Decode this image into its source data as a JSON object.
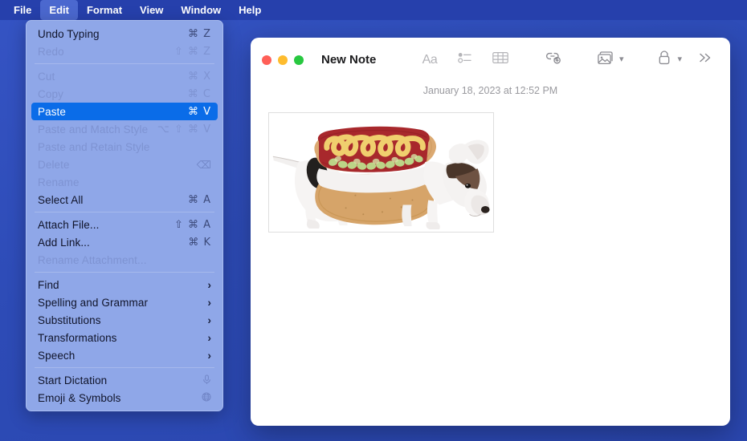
{
  "menubar": {
    "items": [
      {
        "label": "File",
        "active": false
      },
      {
        "label": "Edit",
        "active": true
      },
      {
        "label": "Format",
        "active": false
      },
      {
        "label": "View",
        "active": false
      },
      {
        "label": "Window",
        "active": false
      },
      {
        "label": "Help",
        "active": false
      }
    ]
  },
  "edit_menu": {
    "groups": [
      {
        "rows": [
          {
            "label": "Undo Typing",
            "accel": "⌘ Z",
            "state": "enabled",
            "trailing": ""
          },
          {
            "label": "Redo",
            "accel": "⇧ ⌘ Z",
            "state": "disabled",
            "trailing": ""
          }
        ]
      },
      {
        "rows": [
          {
            "label": "Cut",
            "accel": "⌘ X",
            "state": "disabled",
            "trailing": ""
          },
          {
            "label": "Copy",
            "accel": "⌘ C",
            "state": "disabled",
            "trailing": ""
          },
          {
            "label": "Paste",
            "accel": "⌘ V",
            "state": "highlighted",
            "trailing": ""
          },
          {
            "label": "Paste and Match Style",
            "accel": "⌥ ⇧ ⌘ V",
            "state": "disabled",
            "trailing": ""
          },
          {
            "label": "Paste and Retain Style",
            "accel": "",
            "state": "disabled",
            "trailing": ""
          },
          {
            "label": "Delete",
            "accel": "",
            "state": "disabled",
            "trailing": "⌫"
          },
          {
            "label": "Rename",
            "accel": "",
            "state": "disabled",
            "trailing": ""
          },
          {
            "label": "Select All",
            "accel": "⌘ A",
            "state": "enabled",
            "trailing": ""
          }
        ]
      },
      {
        "rows": [
          {
            "label": "Attach File...",
            "accel": "⇧ ⌘ A",
            "state": "enabled",
            "trailing": ""
          },
          {
            "label": "Add Link...",
            "accel": "⌘ K",
            "state": "enabled",
            "trailing": ""
          },
          {
            "label": "Rename Attachment...",
            "accel": "",
            "state": "disabled",
            "trailing": ""
          }
        ]
      },
      {
        "rows": [
          {
            "label": "Find",
            "accel": "",
            "state": "enabled",
            "trailing": "›"
          },
          {
            "label": "Spelling and Grammar",
            "accel": "",
            "state": "enabled",
            "trailing": "›"
          },
          {
            "label": "Substitutions",
            "accel": "",
            "state": "enabled",
            "trailing": "›"
          },
          {
            "label": "Transformations",
            "accel": "",
            "state": "enabled",
            "trailing": "›"
          },
          {
            "label": "Speech",
            "accel": "",
            "state": "enabled",
            "trailing": "›"
          }
        ]
      },
      {
        "rows": [
          {
            "label": "Start Dictation",
            "accel": "",
            "state": "enabled",
            "trailing": "🎙"
          },
          {
            "label": "Emoji & Symbols",
            "accel": "",
            "state": "enabled",
            "trailing": "☼"
          }
        ]
      }
    ]
  },
  "notes_window": {
    "title": "New Note",
    "traffic_lights": [
      {
        "name": "close",
        "color": "#ff5f57"
      },
      {
        "name": "minimize",
        "color": "#febc2e"
      },
      {
        "name": "maximize",
        "color": "#28c840"
      }
    ],
    "toolbar": [
      {
        "icon": "format-aa-icon",
        "label": "Aa",
        "chevron": false
      },
      {
        "icon": "checklist-icon",
        "label": "",
        "chevron": false
      },
      {
        "icon": "table-icon",
        "label": "",
        "chevron": false
      },
      {
        "icon": "add-link-icon",
        "label": "",
        "chevron": false
      },
      {
        "icon": "media-icon",
        "label": "",
        "chevron": true
      },
      {
        "icon": "lock-icon",
        "label": "",
        "chevron": true
      },
      {
        "icon": "more-chevrons-icon",
        "label": "",
        "chevron": false
      }
    ],
    "date": "January 18, 2023 at 12:52 PM",
    "attachment": {
      "name": "dog-in-hotdog-costume-image",
      "alt": "Dog wearing a hot dog costume"
    }
  },
  "colors": {
    "desktop_blue": "#2d4bb6",
    "menubar_blue": "#2640ac",
    "menu_panel": "#8fa7e8",
    "highlight_blue": "#0a6ce8",
    "menu_text": "#10142a",
    "menu_text_disabled": "#7e93d2"
  }
}
